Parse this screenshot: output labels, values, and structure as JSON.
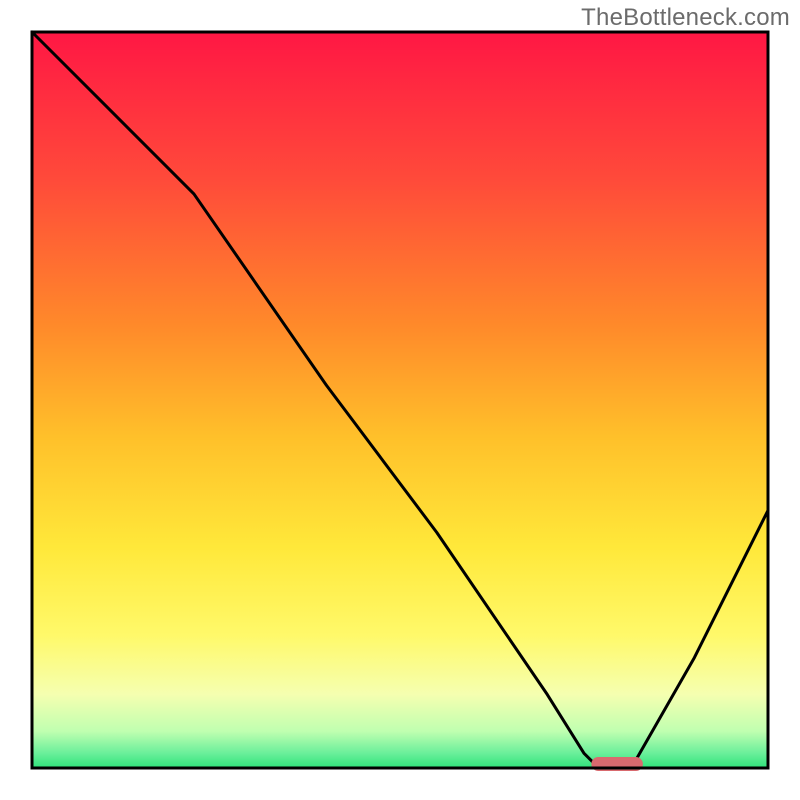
{
  "watermark": "TheBottleneck.com",
  "chart_data": {
    "type": "line",
    "title": "",
    "xlabel": "",
    "ylabel": "",
    "xlim": [
      0,
      100
    ],
    "ylim": [
      0,
      100
    ],
    "grid": false,
    "legend": false,
    "gradient_stops": [
      {
        "offset": 0,
        "color": "#ff1744"
      },
      {
        "offset": 20,
        "color": "#ff4a3a"
      },
      {
        "offset": 40,
        "color": "#ff8a2a"
      },
      {
        "offset": 55,
        "color": "#ffc02a"
      },
      {
        "offset": 70,
        "color": "#ffe83a"
      },
      {
        "offset": 82,
        "color": "#fff96a"
      },
      {
        "offset": 90,
        "color": "#f5ffb0"
      },
      {
        "offset": 95,
        "color": "#c0ffb0"
      },
      {
        "offset": 98,
        "color": "#6aef9a"
      },
      {
        "offset": 100,
        "color": "#2fe37a"
      }
    ],
    "series": [
      {
        "name": "bottleneck-curve",
        "x": [
          0,
          10,
          22,
          40,
          55,
          70,
          75,
          77,
          80,
          82,
          90,
          100
        ],
        "y": [
          100,
          90,
          78,
          52,
          32,
          10,
          2,
          0,
          0,
          1,
          15,
          35
        ]
      }
    ],
    "highlight_segment": {
      "x_start": 76,
      "x_end": 83,
      "color": "#d96a6f"
    },
    "frame": {
      "stroke": "#000000",
      "stroke_width": 3
    }
  }
}
